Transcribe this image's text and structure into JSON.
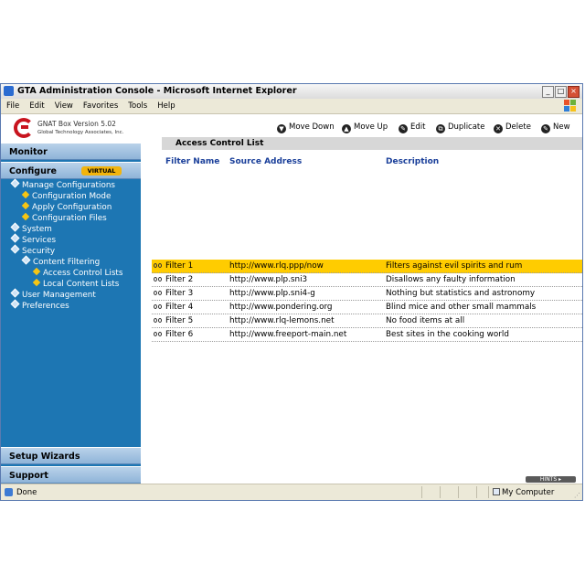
{
  "window": {
    "title": "GTA Administration Console - Microsoft Internet Explorer",
    "controls": [
      "minimize-icon",
      "maximize-icon",
      "close-icon"
    ]
  },
  "menu": [
    "File",
    "Edit",
    "View",
    "Favorites",
    "Tools",
    "Help"
  ],
  "logo": {
    "version": "GNAT Box Version 5.02",
    "company": "Global Technology Associates, Inc."
  },
  "sidebar": {
    "monitor": "Monitor",
    "configure": "Configure",
    "virtual_badge": "VIRTUAL",
    "tree": [
      {
        "label": "Manage Configurations",
        "level": 0
      },
      {
        "label": "Configuration Mode",
        "level": 1
      },
      {
        "label": "Apply Configuration",
        "level": 1
      },
      {
        "label": "Configuration Files",
        "level": 1
      },
      {
        "label": "System",
        "level": 0
      },
      {
        "label": "Services",
        "level": 0
      },
      {
        "label": "Security",
        "level": 0
      },
      {
        "label": "Content Filtering",
        "level": 1
      },
      {
        "label": "Access Control Lists",
        "level": 2
      },
      {
        "label": "Local Content Lists",
        "level": 2
      },
      {
        "label": "User Management",
        "level": 0
      },
      {
        "label": "Preferences",
        "level": 0
      }
    ],
    "setup_wizards": "Setup Wizards",
    "support": "Support"
  },
  "toolbar": {
    "move_down": "Move Down",
    "move_up": "Move Up",
    "edit": "Edit",
    "duplicate": "Duplicate",
    "delete": "Delete",
    "new": "New"
  },
  "list": {
    "title": "Access Control List",
    "columns": [
      "Filter Name",
      "Source Address",
      "Description"
    ],
    "selected_index": 0,
    "rows": [
      [
        "Filter 1",
        "http://www.rlq.ppp/now",
        "Filters against evil spirits and rum"
      ],
      [
        "Filter 2",
        "http://www.plp.sni3",
        "Disallows any faulty information"
      ],
      [
        "Filter 3",
        "http://www.plp.sni4-g",
        "Nothing but statistics and astronomy"
      ],
      [
        "Filter 4",
        "http://www.pondering.org",
        "Blind mice and other small mammals"
      ],
      [
        "Filter 5",
        "http://www.rlq-lemons.net",
        "No food items at all"
      ],
      [
        "Filter 6",
        "http://www.freeport-main.net",
        "Best sites in the cooking world"
      ]
    ]
  },
  "hints": "HINTS",
  "status": {
    "left": "Done",
    "zone": "My Computer"
  },
  "colors": {
    "sidebar_bg": "#1d76b3",
    "selected_row": "#ffcc00",
    "header_text": "#1a3f9a",
    "badge": "#f2b40c"
  }
}
